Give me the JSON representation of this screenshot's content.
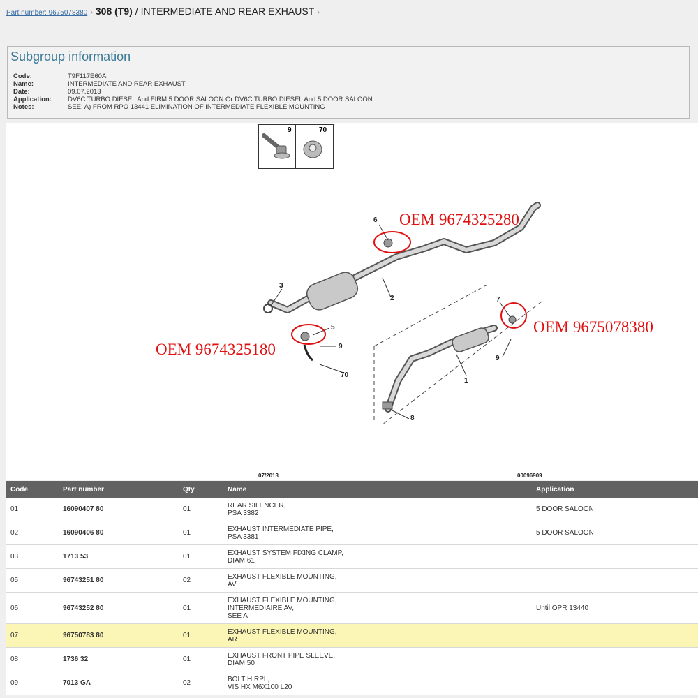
{
  "breadcrumb": {
    "link": "Part number: 9675078380",
    "separator": "›",
    "model": "308 (T9)",
    "title": " / INTERMEDIATE AND REAR EXHAUST",
    "trailing": "›"
  },
  "subgroup": {
    "heading": "Subgroup information",
    "rows": [
      {
        "k": "Code:",
        "v": "T9F117E60A"
      },
      {
        "k": "Name:",
        "v": "INTERMEDIATE AND REAR EXHAUST"
      },
      {
        "k": "Date:",
        "v": "09.07.2013"
      },
      {
        "k": "Application:",
        "v": "DV6C TURBO DIESEL And FIRM 5 DOOR SALOON Or DV6C TURBO DIESEL And 5 DOOR SALOON"
      },
      {
        "k": "Notes:",
        "v": "SEE: A) FROM RPO 13441 ELIMINATION OF INTERMEDIATE FLEXIBLE MOUNTING"
      }
    ]
  },
  "diagram": {
    "thumb_labels": [
      "9",
      "70"
    ],
    "callouts": [
      "6",
      "3",
      "2",
      "5",
      "9",
      "70",
      "7",
      "9",
      "1",
      "8"
    ],
    "oem": [
      "OEM 9674325280",
      "OEM 9675078380",
      "OEM 9674325180"
    ],
    "date_stamp": "07/2013",
    "ref_number": "00096909",
    "oem_color": "#e01010"
  },
  "table": {
    "headers": {
      "code": "Code",
      "pn": "Part number",
      "qty": "Qty",
      "name": "Name",
      "app": "Application"
    },
    "rows": [
      {
        "code": "01",
        "pn": "16090407 80",
        "qty": "01",
        "name1": "REAR SILENCER,",
        "name2": "PSA 3382",
        "name3": "",
        "app": "5 DOOR SALOON"
      },
      {
        "code": "02",
        "pn": "16090406 80",
        "qty": "01",
        "name1": "EXHAUST INTERMEDIATE PIPE,",
        "name2": "PSA 3381",
        "name3": "",
        "app": "5 DOOR SALOON"
      },
      {
        "code": "03",
        "pn": "1713 53",
        "qty": "01",
        "name1": "EXHAUST SYSTEM FIXING CLAMP,",
        "name2": "DIAM 61",
        "name3": "",
        "app": ""
      },
      {
        "code": "05",
        "pn": "96743251 80",
        "qty": "02",
        "name1": "EXHAUST FLEXIBLE MOUNTING,",
        "name2": "AV",
        "name3": "",
        "app": ""
      },
      {
        "code": "06",
        "pn": "96743252 80",
        "qty": "01",
        "name1": "EXHAUST FLEXIBLE MOUNTING,",
        "name2": "INTERMEDIAIRE AV,",
        "name3": "SEE A",
        "app": "Until OPR 13440"
      },
      {
        "code": "07",
        "pn": "96750783 80",
        "qty": "01",
        "name1": "EXHAUST FLEXIBLE MOUNTING,",
        "name2": "AR",
        "name3": "",
        "app": ""
      },
      {
        "code": "08",
        "pn": "1736 32",
        "qty": "01",
        "name1": "EXHAUST FRONT PIPE SLEEVE,",
        "name2": "DIAM 50",
        "name3": "",
        "app": ""
      },
      {
        "code": "09",
        "pn": "7013 GA",
        "qty": "02",
        "name1": "BOLT H RPL,",
        "name2": "VIS HX M6X100 L20",
        "name3": "",
        "app": ""
      }
    ]
  }
}
